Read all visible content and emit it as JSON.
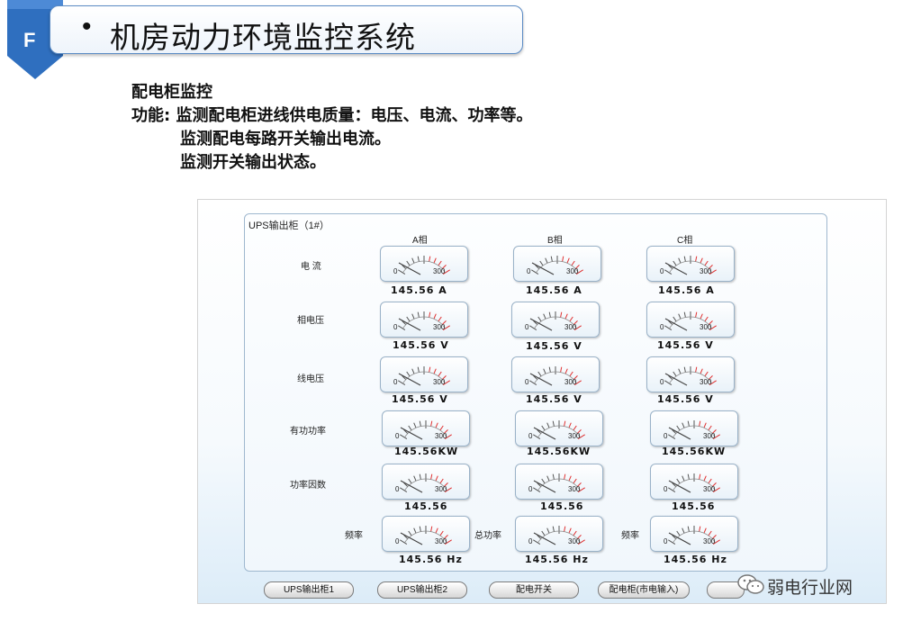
{
  "slide": {
    "badge_letter": "F",
    "bullet": "•",
    "title": "机房动力环境监控系统"
  },
  "description": {
    "heading": "配电柜监控",
    "line1": "功能: 监测配电柜进线供电质量：电压、电流、功率等。",
    "line2": "监测配电每路开关输出电流。",
    "line3": "监测开关输出状态。"
  },
  "screen": {
    "frame_title": "UPS输出柜（1#）",
    "phases": [
      "A相",
      "B相",
      "C相"
    ],
    "gauge_min_label": "0",
    "gauge_max_label": "300",
    "rows": [
      {
        "label": "电 流",
        "values": [
          "145.56  A",
          "145.56  A",
          "145.56  A"
        ]
      },
      {
        "label": "相电压",
        "values": [
          "145.56  V",
          "145.56  V",
          "145.56  V"
        ]
      },
      {
        "label": "线电压",
        "values": [
          "145.56  V",
          "145.56  V",
          "145.56  V"
        ]
      },
      {
        "label": "有功功率",
        "values": [
          "145.56KW",
          "145.56KW",
          "145.56KW"
        ]
      },
      {
        "label": "功率因数",
        "values": [
          "145.56",
          "145.56",
          "145.56"
        ]
      },
      {
        "labels": [
          "频率",
          "总功率",
          "频率"
        ],
        "values": [
          "145.56  Hz",
          "145.56  Hz",
          "145.56  Hz"
        ]
      }
    ],
    "buttons": [
      "UPS输出柜1",
      "UPS输出柜2",
      "配电开关",
      "配电柜(市电输入)"
    ]
  },
  "watermark": {
    "text": "弱电行业网",
    "icon": "wechat-icon"
  },
  "colors": {
    "badge": "#2f6fbf",
    "banner_border": "#5b8bc4",
    "gauge_tick": "#e03030",
    "needle": "#444444"
  }
}
